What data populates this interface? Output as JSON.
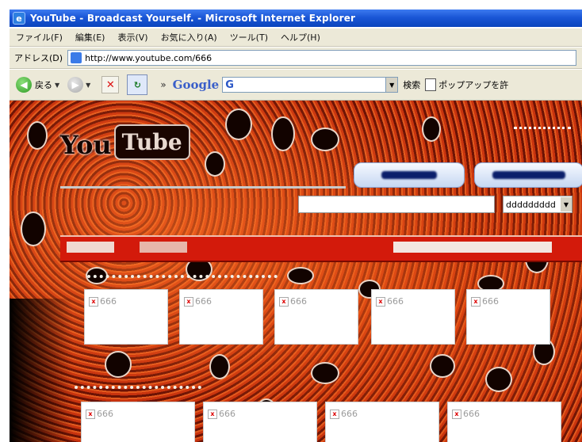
{
  "window": {
    "title": "YouTube - Broadcast Yourself. - Microsoft Internet Explorer"
  },
  "menu": [
    "ファイル(F)",
    "編集(E)",
    "表示(V)",
    "お気に入り(A)",
    "ツール(T)",
    "ヘルプ(H)"
  ],
  "address": {
    "label": "アドレス(D)",
    "url": "http://www.youtube.com/666"
  },
  "toolbar": {
    "back_label": "戻る",
    "google_label": "Google",
    "search_label": "検索",
    "popup_label": "ポップアップを許"
  },
  "page": {
    "logo_left": "You",
    "logo_right": "Tube",
    "select_value": "ddddddddd",
    "thumbs_row1": [
      "666",
      "666",
      "666",
      "666",
      "666"
    ],
    "thumbs_row2": [
      "666",
      "666",
      "666",
      "666"
    ]
  },
  "icons": [
    "ie-logo-icon",
    "page-icon",
    "back-icon",
    "forward-icon",
    "stop-icon",
    "refresh-icon",
    "dropdown-icon",
    "broken-image-icon"
  ],
  "colors": {
    "titlebar": "#1a56d6",
    "chrome": "#ece9d8",
    "page_red": "#d31a0b"
  }
}
